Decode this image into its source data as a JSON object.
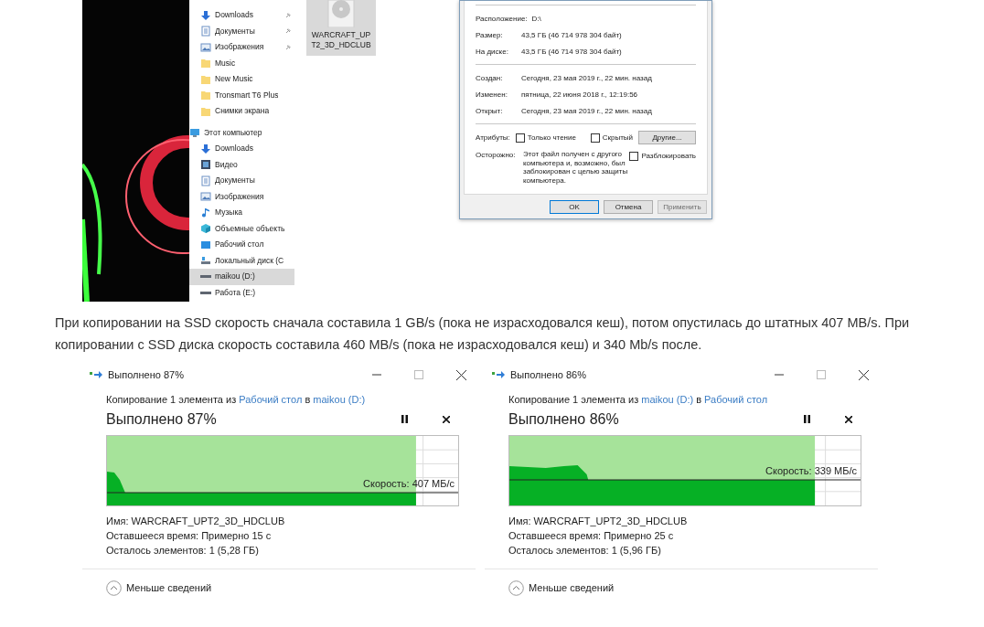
{
  "explorer": {
    "nav_items": [
      {
        "label": "Downloads",
        "kind": "downloads",
        "pinned": true,
        "selected": false
      },
      {
        "label": "Документы",
        "kind": "documents",
        "pinned": true,
        "selected": false
      },
      {
        "label": "Изображения",
        "kind": "pictures",
        "pinned": true,
        "selected": false
      },
      {
        "label": "Music",
        "kind": "folder",
        "pinned": false,
        "selected": false
      },
      {
        "label": "New Music",
        "kind": "folder",
        "pinned": false,
        "selected": false
      },
      {
        "label": "Tronsmart T6 Plus",
        "kind": "folder",
        "pinned": false,
        "selected": false
      },
      {
        "label": "Снимки экрана",
        "kind": "folder",
        "pinned": false,
        "selected": false
      },
      {
        "label": "Этот компьютер",
        "kind": "computer",
        "pinned": false,
        "selected": false,
        "children": [
          {
            "label": "Downloads",
            "kind": "downloads",
            "pinned": false,
            "selected": false
          },
          {
            "label": "Видео",
            "kind": "video",
            "pinned": false,
            "selected": false
          },
          {
            "label": "Документы",
            "kind": "documents",
            "pinned": false,
            "selected": false
          },
          {
            "label": "Изображения",
            "kind": "pictures",
            "pinned": false,
            "selected": false
          },
          {
            "label": "Музыка",
            "kind": "music",
            "pinned": false,
            "selected": false
          },
          {
            "label": "Объемные объекть",
            "kind": "objects",
            "pinned": false,
            "selected": false
          },
          {
            "label": "Рабочий стол",
            "kind": "desktop",
            "pinned": false,
            "selected": false
          },
          {
            "label": "Локальный диск (С",
            "kind": "system-drive",
            "pinned": false,
            "selected": false
          },
          {
            "label": "maikou (D:)",
            "kind": "drive",
            "pinned": false,
            "selected": true
          },
          {
            "label": "Работа (E:)",
            "kind": "drive",
            "pinned": false,
            "selected": false
          }
        ]
      }
    ],
    "file": {
      "name": "WARCRAFT_UPT2_3D_HDCLUB"
    }
  },
  "properties": {
    "groups": [
      [
        {
          "label": "Расположение:",
          "value": "D:\\"
        },
        {
          "label": "Размер:",
          "value": "43,5 ГБ (46 714 978 304 байт)"
        },
        {
          "label": "На диске:",
          "value": "43,5 ГБ (46 714 978 304 байт)"
        }
      ],
      [
        {
          "label": "Создан:",
          "value": "Сегодня, 23 мая 2019 г., 22 мин. назад"
        },
        {
          "label": "Изменен:",
          "value": "пятница, 22 июня 2018 г., 12:19:56"
        },
        {
          "label": "Открыт:",
          "value": "Сегодня, 23 мая 2019 г., 22 мин. назад"
        }
      ]
    ],
    "attributes": {
      "label": "Атрибуты:",
      "readonly": {
        "label": "Только чтение",
        "checked": false
      },
      "hidden": {
        "label": "Скрытый",
        "checked": false
      },
      "button": "Другие..."
    },
    "warning": {
      "label": "Осторожно:",
      "text": "Этот файл получен с другого компьютера и, возможно, был заблокирован с целью защиты компьютера.",
      "unblock": {
        "label": "Разблокировать",
        "checked": false
      }
    },
    "buttons": [
      {
        "label": "OK",
        "disabled": false,
        "default": true
      },
      {
        "label": "Отмена",
        "disabled": false,
        "default": false
      },
      {
        "label": "Применить",
        "disabled": true,
        "default": false
      }
    ]
  },
  "paragraph": "При копировании на SSD скорость сначала составила 1 GB/s (пока не израсходовался кеш), потом опустилась до штатных 407 MB/s. При копировании с SSD диска скорость составила 460 MB/s (пока не израсходовался кеш) и 340 Mb/s после.",
  "copy_dialogs": [
    {
      "title": "Выполнено 87%",
      "source": [
        {
          "kind": "text",
          "text": "Копирование 1 элемента из"
        },
        {
          "kind": "link",
          "text": "Рабочий стол"
        },
        {
          "kind": "text",
          "text": "в"
        },
        {
          "kind": "link",
          "text": "maikou (D:)"
        }
      ],
      "heading": "Выполнено 87%",
      "level": 0.88,
      "speed": "Скорость: 407 МБ/с",
      "details": [
        {
          "label": "Имя:",
          "value": "WARCRAFT_UPT2_3D_HDCLUB"
        },
        {
          "label": "Оставшееся время:",
          "value": "Примерно 15 с"
        },
        {
          "label": "Осталось элементов:",
          "value": "1 (5,28 ГБ)"
        }
      ],
      "less": "Меньше сведений"
    },
    {
      "title": "Выполнено 86%",
      "source": [
        {
          "kind": "text",
          "text": "Копирование 1 элемента из"
        },
        {
          "kind": "link",
          "text": "maikou (D:)"
        },
        {
          "kind": "text",
          "text": "в"
        },
        {
          "kind": "link",
          "text": "Рабочий стол"
        }
      ],
      "heading": "Выполнено 86%",
      "level": 0.87,
      "speed": "Скорость: 339 МБ/с",
      "details": [
        {
          "label": "Имя:",
          "value": "WARCRAFT_UPT2_3D_HDCLUB"
        },
        {
          "label": "Оставшееся время:",
          "value": "Примерно 25 с"
        },
        {
          "label": "Осталось элементов:",
          "value": "1 (5,96 ГБ)"
        }
      ],
      "less": "Меньше сведений"
    }
  ]
}
